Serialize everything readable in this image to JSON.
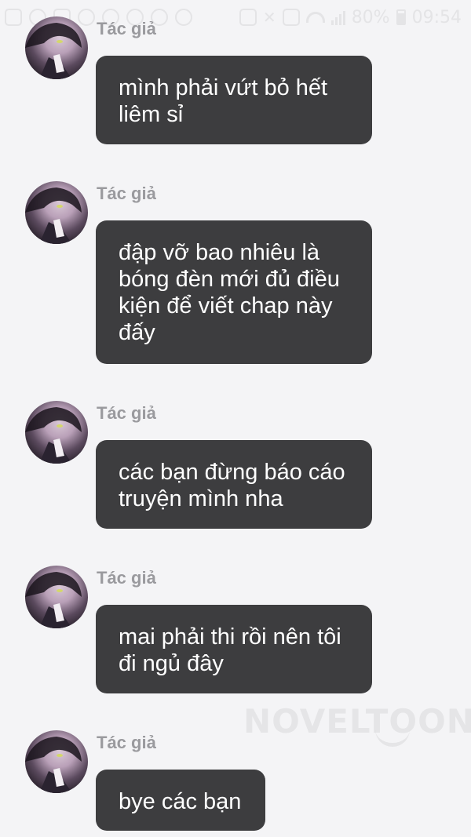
{
  "status_bar": {
    "battery_percent": "80%",
    "time": "09:54"
  },
  "messages": [
    {
      "sender": "Tác giả",
      "text": "mình phải vứt bỏ hết liêm sỉ"
    },
    {
      "sender": "Tác giả",
      "text": "đập vỡ bao nhiêu là bóng đèn mới đủ điều kiện để viết chap này đấy"
    },
    {
      "sender": "Tác giả",
      "text": "các bạn đừng báo cáo truyện mình nha"
    },
    {
      "sender": "Tác giả",
      "text": "mai phải thi rồi nên tôi đi ngủ đây"
    },
    {
      "sender": "Tác giả",
      "text": "bye các bạn"
    }
  ],
  "watermark": "NOVELTOON",
  "colors": {
    "background": "#f4f4f6",
    "bubble": "#3d3d3f",
    "bubble_text": "#ffffff",
    "sender_text": "#9a9a9e"
  }
}
